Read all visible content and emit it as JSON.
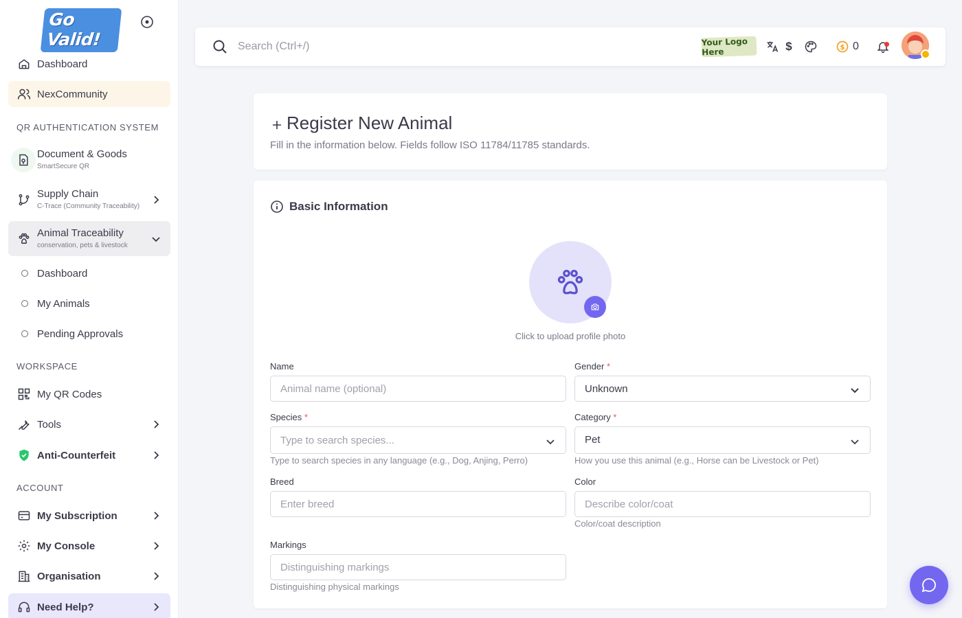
{
  "brand": {
    "logo_text": "Go Valid!"
  },
  "sidebar": {
    "items": [
      {
        "label": "Dashboard"
      },
      {
        "label": "NexCommunity"
      }
    ],
    "sections": {
      "qr": "QR AUTHENTICATION SYSTEM",
      "workspace": "WORKSPACE",
      "account": "ACCOUNT"
    },
    "qr_items": [
      {
        "label": "Document & Goods",
        "sub": "SmartSecure QR"
      },
      {
        "label": "Supply Chain",
        "sub": "C-Trace (Community Traceability)"
      },
      {
        "label": "Animal Traceability",
        "sub": "conservation, pets & livestock"
      }
    ],
    "animal_sub": [
      {
        "label": "Dashboard"
      },
      {
        "label": "My Animals"
      },
      {
        "label": "Pending Approvals"
      }
    ],
    "workspace_items": [
      {
        "label": "My QR Codes"
      },
      {
        "label": "Tools"
      },
      {
        "label": "Anti-Counterfeit"
      }
    ],
    "account_items": [
      {
        "label": "My Subscription"
      },
      {
        "label": "My Console"
      },
      {
        "label": "Organisation"
      },
      {
        "label": "Need Help?"
      }
    ]
  },
  "topbar": {
    "search_placeholder": "Search (Ctrl+/)",
    "logo_placeholder": "Your Logo Here",
    "currency": "$",
    "coins": "0"
  },
  "page": {
    "title": "Register New Animal",
    "description": "Fill in the information below. Fields follow ISO 11784/11785 standards."
  },
  "form": {
    "section_title": "Basic Information",
    "photo_hint": "Click to upload profile photo",
    "name": {
      "label": "Name",
      "placeholder": "Animal name (optional)"
    },
    "gender": {
      "label": "Gender",
      "required": "*",
      "value": "Unknown"
    },
    "species": {
      "label": "Species",
      "required": "*",
      "placeholder": "Type to search species...",
      "helper": "Type to search species in any language (e.g., Dog, Anjing, Perro)"
    },
    "category": {
      "label": "Category",
      "required": "*",
      "value": "Pet",
      "helper": "How you use this animal (e.g., Horse can be Livestock or Pet)"
    },
    "breed": {
      "label": "Breed",
      "placeholder": "Enter breed"
    },
    "color": {
      "label": "Color",
      "placeholder": "Describe color/coat",
      "helper": "Color/coat description"
    },
    "markings": {
      "label": "Markings",
      "placeholder": "Distinguishing markings",
      "helper": "Distinguishing physical markings"
    }
  },
  "colors": {
    "accent": "#7367f0",
    "active_bg": "#fdf6e8",
    "open_bg": "#eeeef0",
    "danger": "#ea5455"
  }
}
